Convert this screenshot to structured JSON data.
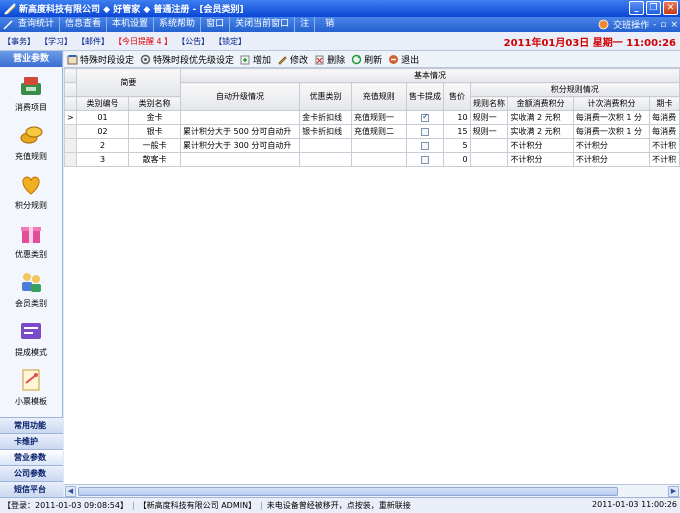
{
  "window": {
    "title": "新高度科技有限公司  ◆  好管家  ◆   普通注册 - [会员类别]",
    "buttons": [
      "_",
      "❐",
      "✕"
    ]
  },
  "menubar": {
    "items": [
      "查询统计",
      "信息查看",
      "本机设置",
      "系统帮助",
      "窗口",
      "关闭当前窗口",
      "注",
      "销"
    ],
    "right_label": "交班操作",
    "right_icons": [
      "-",
      "▫",
      "×"
    ]
  },
  "status_tags": [
    "【事务】",
    "【学习】",
    "【邮件】",
    "【今日提醒 4 】",
    "【公告】",
    "【锁定】"
  ],
  "clock": "2011年01月03日 星期一 11:00:26",
  "sidebar": {
    "header": "营业参数",
    "items": [
      {
        "label": "消费项目",
        "icon": "cash-register-icon"
      },
      {
        "label": "充值规则",
        "icon": "coins-icon"
      },
      {
        "label": "积分规则",
        "icon": "points-icon"
      },
      {
        "label": "优惠类别",
        "icon": "gift-icon"
      },
      {
        "label": "会员类别",
        "icon": "members-icon"
      },
      {
        "label": "提成模式",
        "icon": "commission-icon"
      },
      {
        "label": "小票模板",
        "icon": "receipt-icon"
      }
    ],
    "categories": [
      "常用功能",
      "卡维护",
      "营业参数",
      "公司参数",
      "短信平台"
    ]
  },
  "toolbar": {
    "items": [
      {
        "label": "特殊时段设定",
        "icon": "clock-icon"
      },
      {
        "label": "特殊时段优先级设定",
        "icon": "priority-icon"
      },
      {
        "label": "增加",
        "icon": "add-icon"
      },
      {
        "label": "修改",
        "icon": "edit-icon"
      },
      {
        "label": "删除",
        "icon": "delete-icon"
      },
      {
        "label": "刷新",
        "icon": "refresh-icon"
      },
      {
        "label": "退出",
        "icon": "exit-icon"
      }
    ]
  },
  "grid": {
    "group_brief": "简要",
    "group_basic": "基本情况",
    "group_points": "积分规则情况",
    "columns": [
      "类别编号",
      "类别名称",
      "自动升级情况",
      "优惠类别",
      "充值规则",
      "售卡提成",
      "售价",
      "规则名称",
      "金额消费积分",
      "计次消费积分",
      "期卡"
    ],
    "rows": [
      {
        "code": "01",
        "name": "金卡",
        "upgrade": "",
        "discount": "金卡折扣线",
        "recharge": "充值规则一",
        "commission": true,
        "price": "10",
        "rule": "规则一",
        "amount_points": "实收满 2 元积",
        "count_points": "每消费一次积 1 分",
        "period_points": "每消费"
      },
      {
        "code": "02",
        "name": "银卡",
        "upgrade": "累计积分大于 500 分可自动升",
        "discount": "银卡折扣线",
        "recharge": "充值规则二",
        "commission": false,
        "price": "15",
        "rule": "规则一",
        "amount_points": "实收满 2 元积",
        "count_points": "每消费一次积 1 分",
        "period_points": "每消费"
      },
      {
        "code": "2",
        "name": "一般卡",
        "upgrade": "累计积分大于 300 分可自动升",
        "discount": "",
        "recharge": "",
        "commission": false,
        "price": "5",
        "rule": "",
        "amount_points": "不计积分",
        "count_points": "不计积分",
        "period_points": "不计积"
      },
      {
        "code": "3",
        "name": "散客卡",
        "upgrade": "",
        "discount": "",
        "recharge": "",
        "commission": false,
        "price": "0",
        "rule": "",
        "amount_points": "不计积分",
        "count_points": "不计积分",
        "period_points": "不计积"
      }
    ]
  },
  "footer": {
    "login": "【登录：2011-01-03 09:08:54】",
    "company": "【新高度科技有限公司  ADMIN】",
    "message": "未电设备曾经被移开，点按装，重新联接",
    "datetime": "2011-01-03 11:00:26"
  }
}
